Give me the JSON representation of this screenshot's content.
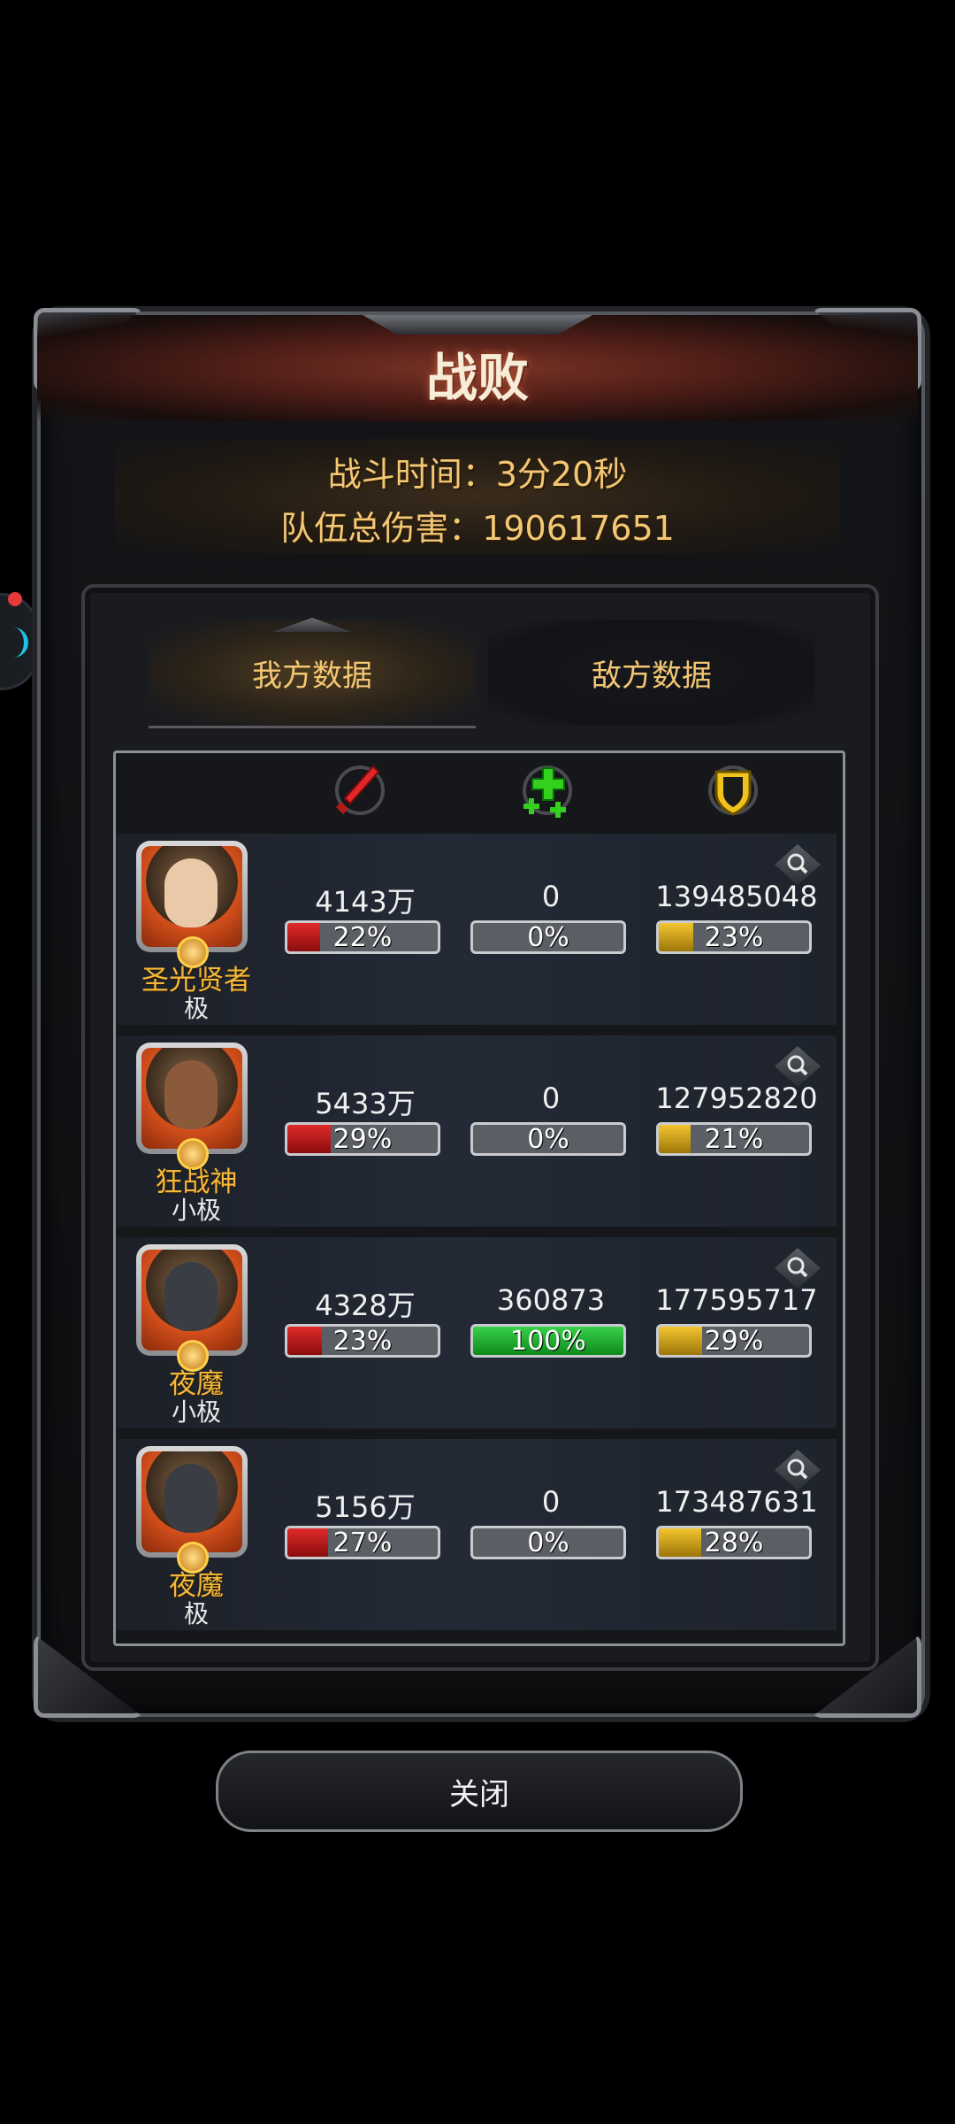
{
  "dialog": {
    "title": "战败",
    "battle_time": "战斗时间：3分20秒",
    "total_damage": "队伍总伤害：190617651"
  },
  "tabs": {
    "mine": "我方数据",
    "enemy": "敌方数据",
    "active": "mine"
  },
  "columns": {
    "attack_icon": "sword-icon",
    "heal_icon": "heal-cross-icon",
    "defense_icon": "shield-icon"
  },
  "heroes": [
    {
      "name": "圣光贤者",
      "tier": "极",
      "damage": "4143万",
      "damage_pct": "22%",
      "damage_frac": 0.22,
      "heal": "0",
      "heal_pct": "0%",
      "heal_frac": 0.0,
      "taken": "139485048",
      "taken_pct": "23%",
      "taken_frac": 0.23,
      "face_color": "#e9c9a8"
    },
    {
      "name": "狂战神",
      "tier": "小极",
      "damage": "5433万",
      "damage_pct": "29%",
      "damage_frac": 0.29,
      "heal": "0",
      "heal_pct": "0%",
      "heal_frac": 0.0,
      "taken": "127952820",
      "taken_pct": "21%",
      "taken_frac": 0.21,
      "face_color": "#8a5a3a"
    },
    {
      "name": "夜魔",
      "tier": "小极",
      "damage": "4328万",
      "damage_pct": "23%",
      "damage_frac": 0.23,
      "heal": "360873",
      "heal_pct": "100%",
      "heal_frac": 1.0,
      "taken": "177595717",
      "taken_pct": "29%",
      "taken_frac": 0.29,
      "face_color": "#3a3d44"
    },
    {
      "name": "夜魔",
      "tier": "极",
      "damage": "5156万",
      "damage_pct": "27%",
      "damage_frac": 0.27,
      "heal": "0",
      "heal_pct": "0%",
      "heal_frac": 0.0,
      "taken": "173487631",
      "taken_pct": "28%",
      "taken_frac": 0.28,
      "face_color": "#3a3d44"
    }
  ],
  "close_button": "关闭",
  "colors": {
    "accent_gold": "#f3c774",
    "damage_red": "#e02a2a",
    "heal_green": "#3ad14a",
    "taken_yellow": "#f4c531"
  }
}
